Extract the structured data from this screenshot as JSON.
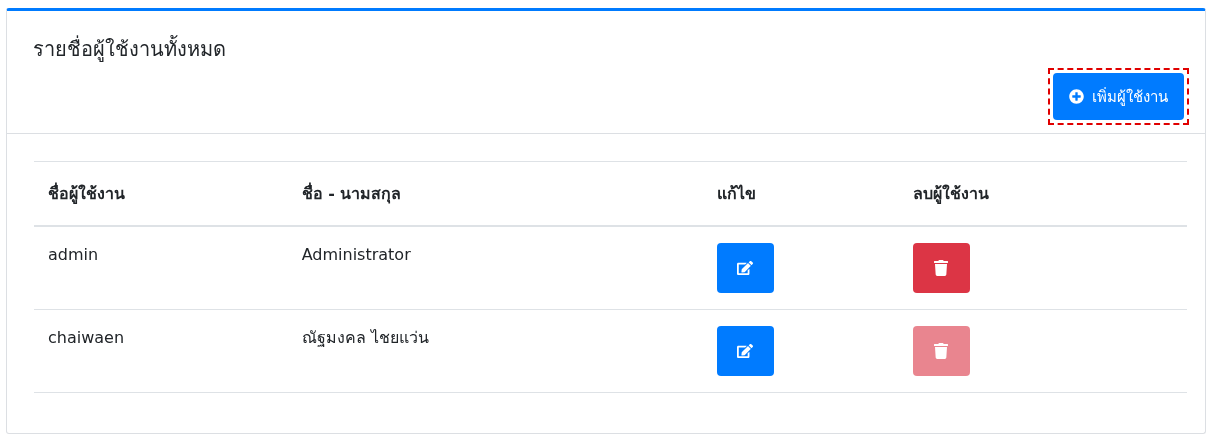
{
  "card": {
    "title": "รายชื่อผู้ใช้งานทั้งหมด",
    "add_button": {
      "label": "เพิ่มผู้ใช้งาน",
      "highlighted": true
    }
  },
  "table": {
    "columns": [
      "ชื่อผู้ใช้งาน",
      "ชื่อ - นามสกุล",
      "แก้ไข",
      "ลบผู้ใช้งาน"
    ],
    "rows": [
      {
        "username": "admin",
        "full_name": "Administrator",
        "delete_disabled": false
      },
      {
        "username": "chaiwaen",
        "full_name": "ณัฐมงคล ไชยแว่น",
        "delete_disabled": true
      }
    ]
  }
}
